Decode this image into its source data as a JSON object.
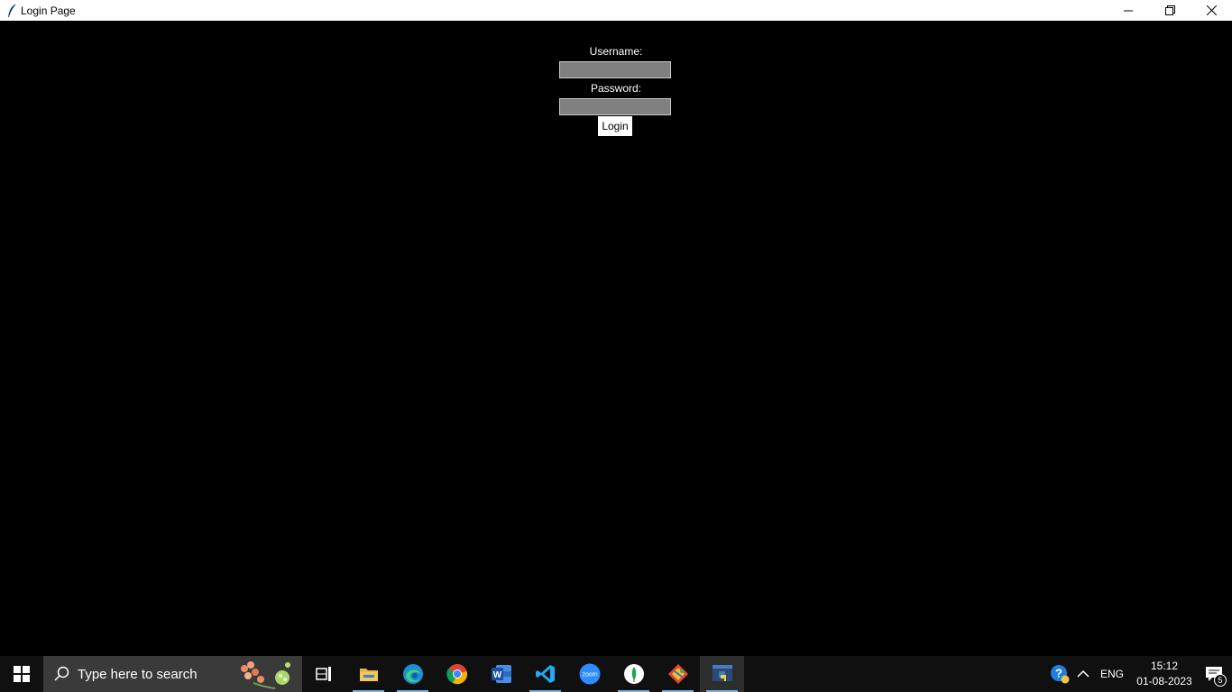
{
  "window": {
    "title": "Login Page",
    "icon": "feather-icon",
    "controls": [
      "minimize-icon",
      "restore-icon",
      "close-icon"
    ]
  },
  "form": {
    "username_label": "Username:",
    "username_value": "",
    "password_label": "Password:",
    "password_value": "",
    "login_label": "Login"
  },
  "taskbar": {
    "search_placeholder": "Type here to search",
    "apps": [
      "task-view",
      "file-explorer",
      "edge",
      "chrome",
      "word",
      "vscode",
      "zoom",
      "mongodb-compass",
      "git-gui",
      "python-app"
    ],
    "zoom_label": "zoom",
    "tray": {
      "lang": "ENG",
      "time": "15:12",
      "date": "01-08-2023",
      "notifications": "5"
    }
  },
  "colors": {
    "background": "#000000",
    "field": "#808080",
    "taskbar": "#101010",
    "running_indicator": "#7ab1e2"
  }
}
